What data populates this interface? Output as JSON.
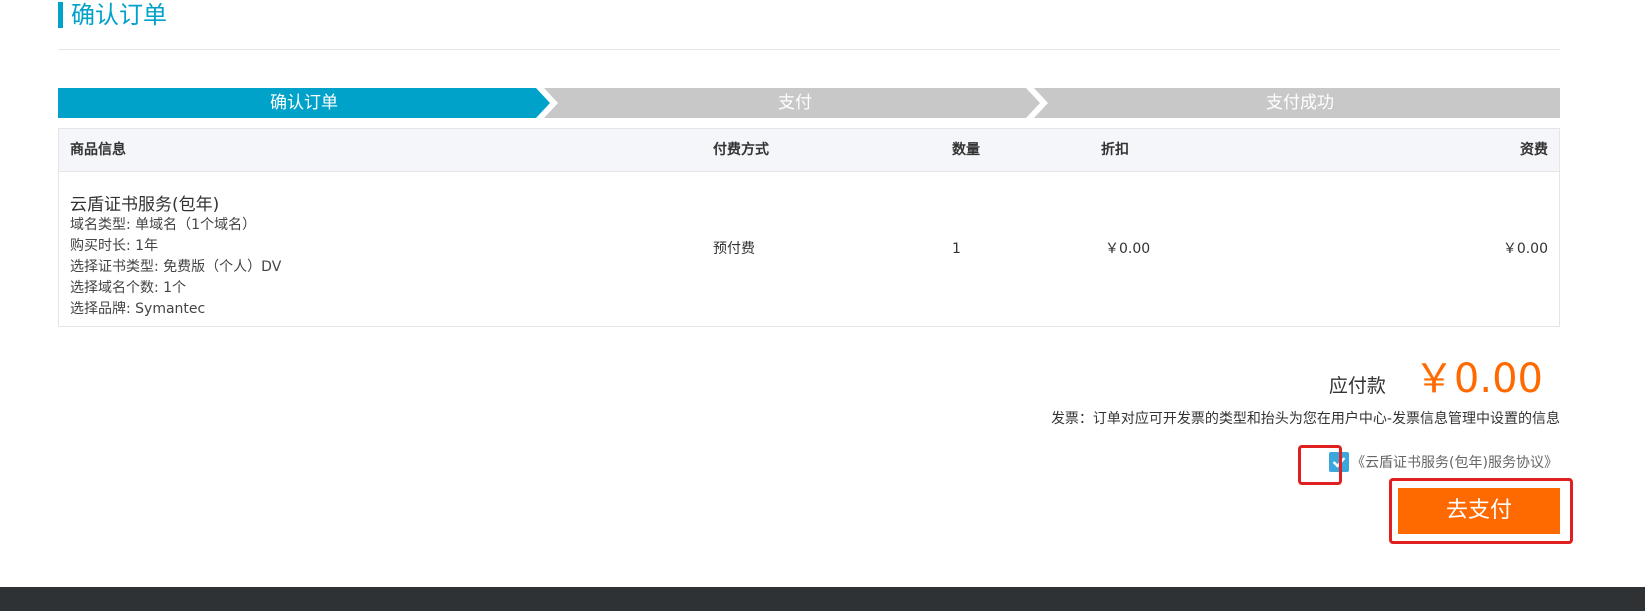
{
  "page": {
    "title": "确认订单"
  },
  "steps": [
    {
      "label": "确认订单",
      "active": true
    },
    {
      "label": "支付",
      "active": false
    },
    {
      "label": "支付成功",
      "active": false
    }
  ],
  "table": {
    "headers": {
      "product": "商品信息",
      "payment_method": "付费方式",
      "quantity": "数量",
      "discount": "折扣",
      "fee": "资费"
    },
    "rows": [
      {
        "product_name": "云盾证书服务(包年)",
        "attributes": [
          "域名类型: 单域名（1个域名）",
          "购买时长: 1年",
          "选择证书类型: 免费版（个人）DV",
          "选择域名个数: 1个",
          "选择品牌: Symantec"
        ],
        "payment_method": "预付费",
        "quantity": "1",
        "discount": "￥0.00",
        "fee": "￥0.00"
      }
    ]
  },
  "summary": {
    "amount_label": "应付款",
    "amount_value": "￥0.00",
    "invoice_note": "发票：订单对应可开发票的类型和抬头为您在用户中心-发票信息管理中设置的信息"
  },
  "agreement": {
    "checked": true,
    "text": "《云盾证书服务(包年)服务协议》"
  },
  "actions": {
    "pay_label": "去支付"
  },
  "colors": {
    "brand": "#00a2ca",
    "step_inactive": "#c8c8c8",
    "accent": "#ff6a00",
    "checkbox": "#3aa8dc",
    "highlight": "#e02020",
    "footer": "#2f3235"
  }
}
